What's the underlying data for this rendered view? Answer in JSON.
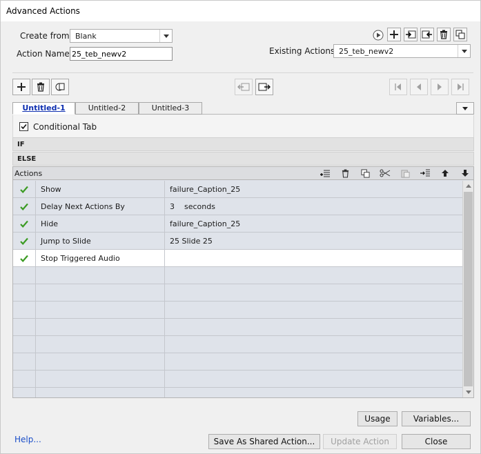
{
  "window": {
    "title": "Advanced Actions"
  },
  "form": {
    "create_from_label": "Create from:",
    "create_from_value": "Blank",
    "action_name_label": "Action Name:",
    "action_name_value": "25_teb_newv2",
    "existing_actions_label": "Existing Actions:",
    "existing_actions_value": "25_teb_newv2"
  },
  "top_toolbar_icons": [
    "preview-icon",
    "add-action-icon",
    "import-icon",
    "export-icon",
    "delete-action-icon",
    "duplicate-action-icon"
  ],
  "decision_toolbar_icons": [
    "add-decision-icon",
    "delete-decision-icon",
    "duplicate-decision-icon",
    "move-left-icon",
    "move-right-icon",
    "first-icon",
    "previous-icon",
    "next-icon",
    "last-icon"
  ],
  "tabs": [
    {
      "label": "Untitled-1",
      "active": true
    },
    {
      "label": "Untitled-2",
      "active": false
    },
    {
      "label": "Untitled-3",
      "active": false
    }
  ],
  "conditional": {
    "label": "Conditional Tab",
    "checked": true
  },
  "if_label": "IF",
  "else_label": "ELSE",
  "actions_grid": {
    "header": "Actions",
    "toolbar_icons": [
      "insert-row-icon",
      "delete-row-icon",
      "copy-row-icon",
      "cut-row-icon",
      "paste-row-icon",
      "insert-after-icon",
      "move-up-icon",
      "move-down-icon"
    ],
    "rows": [
      {
        "action": "Show",
        "target": "failure_Caption_25",
        "checked": true,
        "selected": false
      },
      {
        "action": "Delay Next Actions By",
        "target": "3    seconds",
        "checked": true,
        "selected": false
      },
      {
        "action": "Hide",
        "target": "failure_Caption_25",
        "checked": true,
        "selected": false
      },
      {
        "action": "Jump to Slide",
        "target": "25 Slide 25",
        "checked": true,
        "selected": false
      },
      {
        "action": "Stop Triggered Audio",
        "target": "",
        "checked": true,
        "selected": true
      }
    ],
    "empty_rows": 8
  },
  "buttons": {
    "usage": "Usage",
    "variables": "Variables...",
    "help": "Help...",
    "save_shared": "Save As Shared Action...",
    "update": "Update Action",
    "close": "Close"
  },
  "colors": {
    "check_green": "#3b9b23",
    "link_blue": "#1a4ec8",
    "active_tab": "#0e2fb0"
  }
}
